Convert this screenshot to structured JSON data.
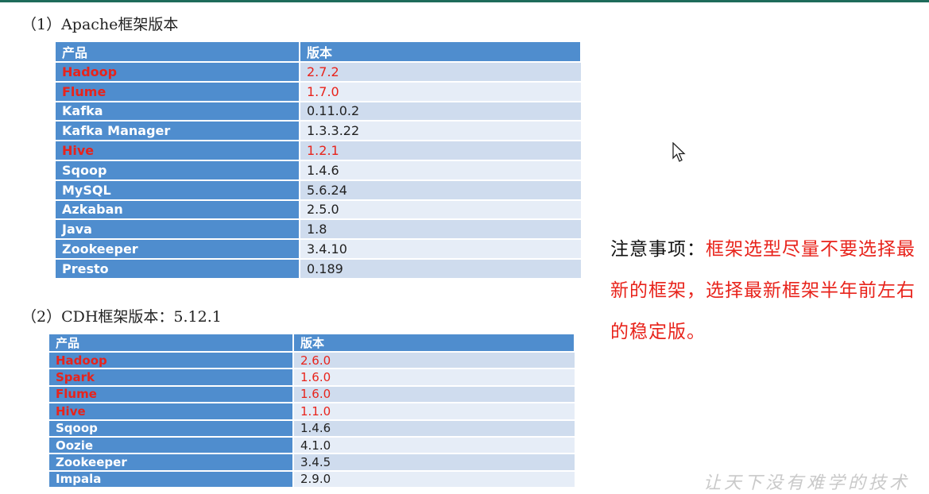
{
  "section1": {
    "heading": "（1）Apache框架版本",
    "header": {
      "product": "产品",
      "version": "版本"
    },
    "rows": [
      {
        "product": "Hadoop",
        "version": "2.7.2",
        "highlight": true
      },
      {
        "product": "Flume",
        "version": "1.7.0",
        "highlight": true
      },
      {
        "product": "Kafka",
        "version": "0.11.0.2",
        "highlight": false
      },
      {
        "product": "Kafka Manager",
        "version": "1.3.3.22",
        "highlight": false
      },
      {
        "product": "Hive",
        "version": "1.2.1",
        "highlight": true
      },
      {
        "product": "Sqoop",
        "version": "1.4.6",
        "highlight": false
      },
      {
        "product": "MySQL",
        "version": "5.6.24",
        "highlight": false
      },
      {
        "product": "Azkaban",
        "version": "2.5.0",
        "highlight": false
      },
      {
        "product": "Java",
        "version": "1.8",
        "highlight": false
      },
      {
        "product": "Zookeeper",
        "version": "3.4.10",
        "highlight": false
      },
      {
        "product": "Presto",
        "version": "0.189",
        "highlight": false
      }
    ]
  },
  "section2": {
    "heading": "（2）CDH框架版本：5.12.1",
    "header": {
      "product": "产品",
      "version": "版本"
    },
    "rows": [
      {
        "product": "Hadoop",
        "version": "2.6.0",
        "highlight": true
      },
      {
        "product": "Spark",
        "version": "1.6.0",
        "highlight": true
      },
      {
        "product": "Flume",
        "version": "1.6.0",
        "highlight": true
      },
      {
        "product": "Hive",
        "version": "1.1.0",
        "highlight": true
      },
      {
        "product": "Sqoop",
        "version": "1.4.6",
        "highlight": false
      },
      {
        "product": "Oozie",
        "version": "4.1.0",
        "highlight": false
      },
      {
        "product": "Zookeeper",
        "version": "3.4.5",
        "highlight": false
      },
      {
        "product": "Impala",
        "version": "2.9.0",
        "highlight": false
      }
    ]
  },
  "note": {
    "label": "注意事项：",
    "text": "框架选型尽量不要选择最新的框架，选择最新框架半年前左右的稳定版。"
  },
  "watermark": "让天下没有难学的技术",
  "colors": {
    "header_blue": "#4f8dce",
    "highlight_red": "#e8231b",
    "row_light": "#e6edf7",
    "row_dark": "#cfdcee"
  },
  "icons": {
    "cursor": "mouse-pointer-icon"
  }
}
